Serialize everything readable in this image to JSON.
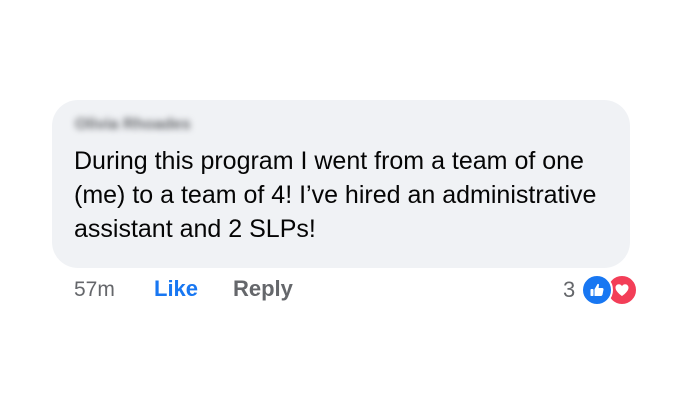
{
  "comment": {
    "author": "Olivia Rhoades",
    "text": "During this program I went from a team of one (me) to a team of 4! I’ve hired an administrative assistant and 2 SLPs!",
    "timestamp": "57m",
    "like_label": "Like",
    "reply_label": "Reply",
    "reaction_count": "3",
    "reactions": [
      "like-icon",
      "love-icon"
    ]
  },
  "colors": {
    "bubble_bg": "#f0f2f5",
    "text": "#050505",
    "secondary_text": "#65676b",
    "like_blue": "#1877f2",
    "love_red": "#f33e58"
  }
}
